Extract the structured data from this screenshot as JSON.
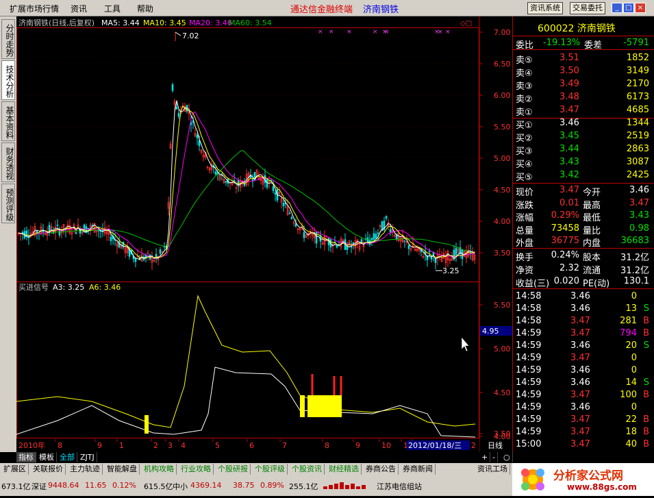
{
  "menu": {
    "items": [
      "扩展市场行情",
      "资讯",
      "工具",
      "帮助"
    ],
    "title": "通达信金融终端",
    "stock_title": "济南钢铁",
    "buttons": [
      "资讯系统",
      "交易委托"
    ],
    "window_controls": [
      "_",
      "□",
      "×"
    ]
  },
  "left_tabs": [
    "分时走势",
    "技术分析",
    "基本资料",
    "财务透视",
    "预测评级"
  ],
  "main_chart": {
    "header": "济南钢铁(日线,后复权)",
    "ma5": "MA5: 3.44",
    "ma10": "MA10: 3.45",
    "ma20": "MA20: 3.46",
    "ma60": "MA60: 3.54",
    "y_ticks": [
      "7.00",
      "6.50",
      "6.00",
      "5.50",
      "5.00",
      "4.50",
      "4.00",
      "3.50"
    ],
    "high_label": "7.02",
    "low_label": "3.25"
  },
  "sub_chart": {
    "header": "买进信号",
    "a3": "A3: 3.25",
    "a6": "A6: 3.46",
    "y_ticks": [
      "5.50",
      "5.00",
      "4.50",
      "4.00",
      "3.50"
    ],
    "cursor_value": "4.95"
  },
  "x_axis": {
    "year": "2010年",
    "months": [
      "8",
      "9",
      "1",
      "2",
      "3",
      "4",
      "5",
      "6",
      "7",
      "8",
      "9",
      "10",
      "11",
      "12"
    ],
    "date_box": "2012/01/18/三",
    "end": "2",
    "period": "日线"
  },
  "bottom_tabs": [
    "指标",
    "模板",
    "全部",
    "ZJTJ"
  ],
  "zoom_buttons": [
    "+",
    "-",
    "○"
  ],
  "function_tabs": [
    "扩展区",
    "关联报价",
    "主力轨迹",
    "智能解盘",
    "机构攻略",
    "行业攻略",
    "个股研报",
    "个股评级",
    "个股资讯",
    "财经精选",
    "券商公告",
    "券商新闻"
  ],
  "function_tab_right": "资讯工场",
  "quote": {
    "code_name": "600022 济南钢铁",
    "weibi_label": "委比",
    "weibi": "-19.13%",
    "weicha_label": "委差",
    "weicha": "-5791",
    "sells": [
      {
        "label": "卖⑤",
        "price": "3.51",
        "vol": "1852"
      },
      {
        "label": "卖④",
        "price": "3.50",
        "vol": "3149"
      },
      {
        "label": "卖③",
        "price": "3.49",
        "vol": "2170"
      },
      {
        "label": "卖②",
        "price": "3.48",
        "vol": "6173"
      },
      {
        "label": "卖①",
        "price": "3.47",
        "vol": "4685"
      }
    ],
    "buys": [
      {
        "label": "买①",
        "price": "3.46",
        "vol": "1344"
      },
      {
        "label": "买②",
        "price": "3.45",
        "vol": "2519"
      },
      {
        "label": "买③",
        "price": "3.44",
        "vol": "2863"
      },
      {
        "label": "买④",
        "price": "3.43",
        "vol": "3087"
      },
      {
        "label": "买⑤",
        "price": "3.42",
        "vol": "2425"
      }
    ],
    "stats": [
      {
        "l1": "现价",
        "v1": "3.47",
        "c1": "#ff3030",
        "l2": "今开",
        "v2": "3.46",
        "c2": "#ffffff"
      },
      {
        "l1": "涨跌",
        "v1": "0.01",
        "c1": "#ff3030",
        "l2": "最高",
        "v2": "3.47",
        "c2": "#ff3030"
      },
      {
        "l1": "涨幅",
        "v1": "0.29%",
        "c1": "#ff3030",
        "l2": "最低",
        "v2": "3.43",
        "c2": "#00e000"
      },
      {
        "l1": "总量",
        "v1": "73458",
        "c1": "#ffff00",
        "l2": "量比",
        "v2": "0.98",
        "c2": "#00e000"
      },
      {
        "l1": "外盘",
        "v1": "36775",
        "c1": "#ff3030",
        "l2": "内盘",
        "v2": "36683",
        "c2": "#00e000"
      }
    ],
    "stats2": [
      {
        "l1": "换手",
        "v1": "0.24%",
        "l2": "股本",
        "v2": "31.2亿"
      },
      {
        "l1": "净资",
        "v1": "2.32",
        "l2": "流通",
        "v2": "31.2亿"
      },
      {
        "l1": "收益(三)",
        "v1": "0.020",
        "l2": "PE(动)",
        "v2": "130.1"
      }
    ],
    "ticks": [
      {
        "time": "14:58",
        "price": "3.46",
        "pc": "#ffffff",
        "vol": "0",
        "vc": "#ffff00",
        "flag": ""
      },
      {
        "time": "14:58",
        "price": "3.46",
        "pc": "#ffffff",
        "vol": "13",
        "vc": "#ffff00",
        "flag": "S"
      },
      {
        "time": "14:58",
        "price": "3.47",
        "pc": "#ff3030",
        "vol": "281",
        "vc": "#ffff00",
        "flag": "B"
      },
      {
        "time": "14:59",
        "price": "3.47",
        "pc": "#ff3030",
        "vol": "794",
        "vc": "#ff00ff",
        "flag": "B"
      },
      {
        "time": "14:59",
        "price": "3.46",
        "pc": "#ffffff",
        "vol": "20",
        "vc": "#ffff00",
        "flag": "S"
      },
      {
        "time": "14:59",
        "price": "3.47",
        "pc": "#ff3030",
        "vol": "0",
        "vc": "#ffff00",
        "flag": ""
      },
      {
        "time": "14:59",
        "price": "3.46",
        "pc": "#ffffff",
        "vol": "0",
        "vc": "#ffff00",
        "flag": ""
      },
      {
        "time": "14:59",
        "price": "3.46",
        "pc": "#ffffff",
        "vol": "14",
        "vc": "#ffff00",
        "flag": "S"
      },
      {
        "time": "14:59",
        "price": "3.47",
        "pc": "#ff3030",
        "vol": "100",
        "vc": "#ffff00",
        "flag": "B"
      },
      {
        "time": "14:59",
        "price": "3.46",
        "pc": "#ffffff",
        "vol": "0",
        "vc": "#ffff00",
        "flag": ""
      },
      {
        "time": "14:59",
        "price": "3.47",
        "pc": "#ff3030",
        "vol": "22",
        "vc": "#ffff00",
        "flag": "B"
      },
      {
        "time": "14:59",
        "price": "3.47",
        "pc": "#ff3030",
        "vol": "18",
        "vc": "#ffff00",
        "flag": "B"
      },
      {
        "time": "15:00",
        "price": "3.47",
        "pc": "#ff3030",
        "vol": "40",
        "vc": "#ffff00",
        "flag": "B"
      }
    ]
  },
  "status_bar": {
    "sh_vol": "673.1亿",
    "sz_label": "深证",
    "sz_index": "9448.64",
    "sz_change": "11.65",
    "sz_pct": "0.12%",
    "sz_vol": "615.5亿",
    "zx_label": "中小",
    "zx_index": "4369.14",
    "zx_change": "38.75",
    "zx_pct": "0.89%",
    "zx_vol": "255.1亿",
    "server": "江苏电信组站"
  },
  "watermark": {
    "brand": "分析家公式网",
    "url": "www.88gs.com"
  },
  "colors": {
    "up": "#ff3030",
    "down": "#00e000",
    "ma5": "#ffffff",
    "ma10": "#ffff00",
    "ma20": "#ff00ff",
    "ma60": "#00c000",
    "grid": "#c00000"
  }
}
